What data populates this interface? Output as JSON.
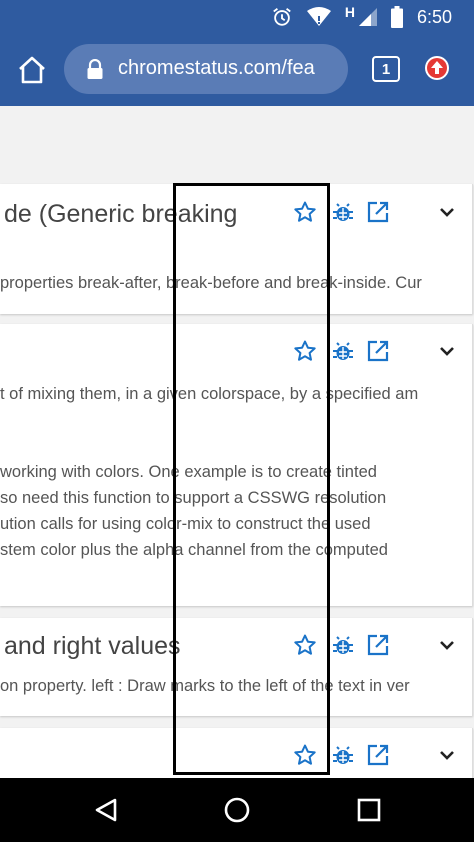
{
  "status_bar": {
    "time": "6:50",
    "network_label": "H",
    "icons": [
      "alarm-icon",
      "wifi-icon",
      "signal-icon",
      "battery-icon"
    ]
  },
  "browser": {
    "url": "chromestatus.com/fea",
    "tab_count": "1",
    "colors": {
      "toolbar": "#2f5ba0",
      "omnibox": "#5a7cb6",
      "link_blue": "#1a73c8",
      "update_red": "#e53935"
    }
  },
  "cards": [
    {
      "title": "de (Generic breaking",
      "lines": [
        "properties break-after, break-before and break-inside. Cur"
      ]
    },
    {
      "title": "",
      "lines": [
        "t of mixing them, in a given colorspace, by a specified am",
        "working with colors. One example is to create tinted",
        "so need this function to support a CSSWG resolution",
        "ution calls for using color-mix to construct the used",
        "stem color plus the alpha channel from the computed"
      ]
    },
    {
      "title": "and right values",
      "lines": [
        "on property. left : Draw marks to the left of the text in ver"
      ]
    },
    {
      "title": "",
      "lines": []
    }
  ],
  "card_action_icons": [
    "star-icon",
    "bug-icon",
    "open-in-new-icon",
    "chevron-down-icon"
  ],
  "nav_bar": {
    "icons": [
      "back-icon",
      "home-circle-icon",
      "recents-icon"
    ]
  }
}
